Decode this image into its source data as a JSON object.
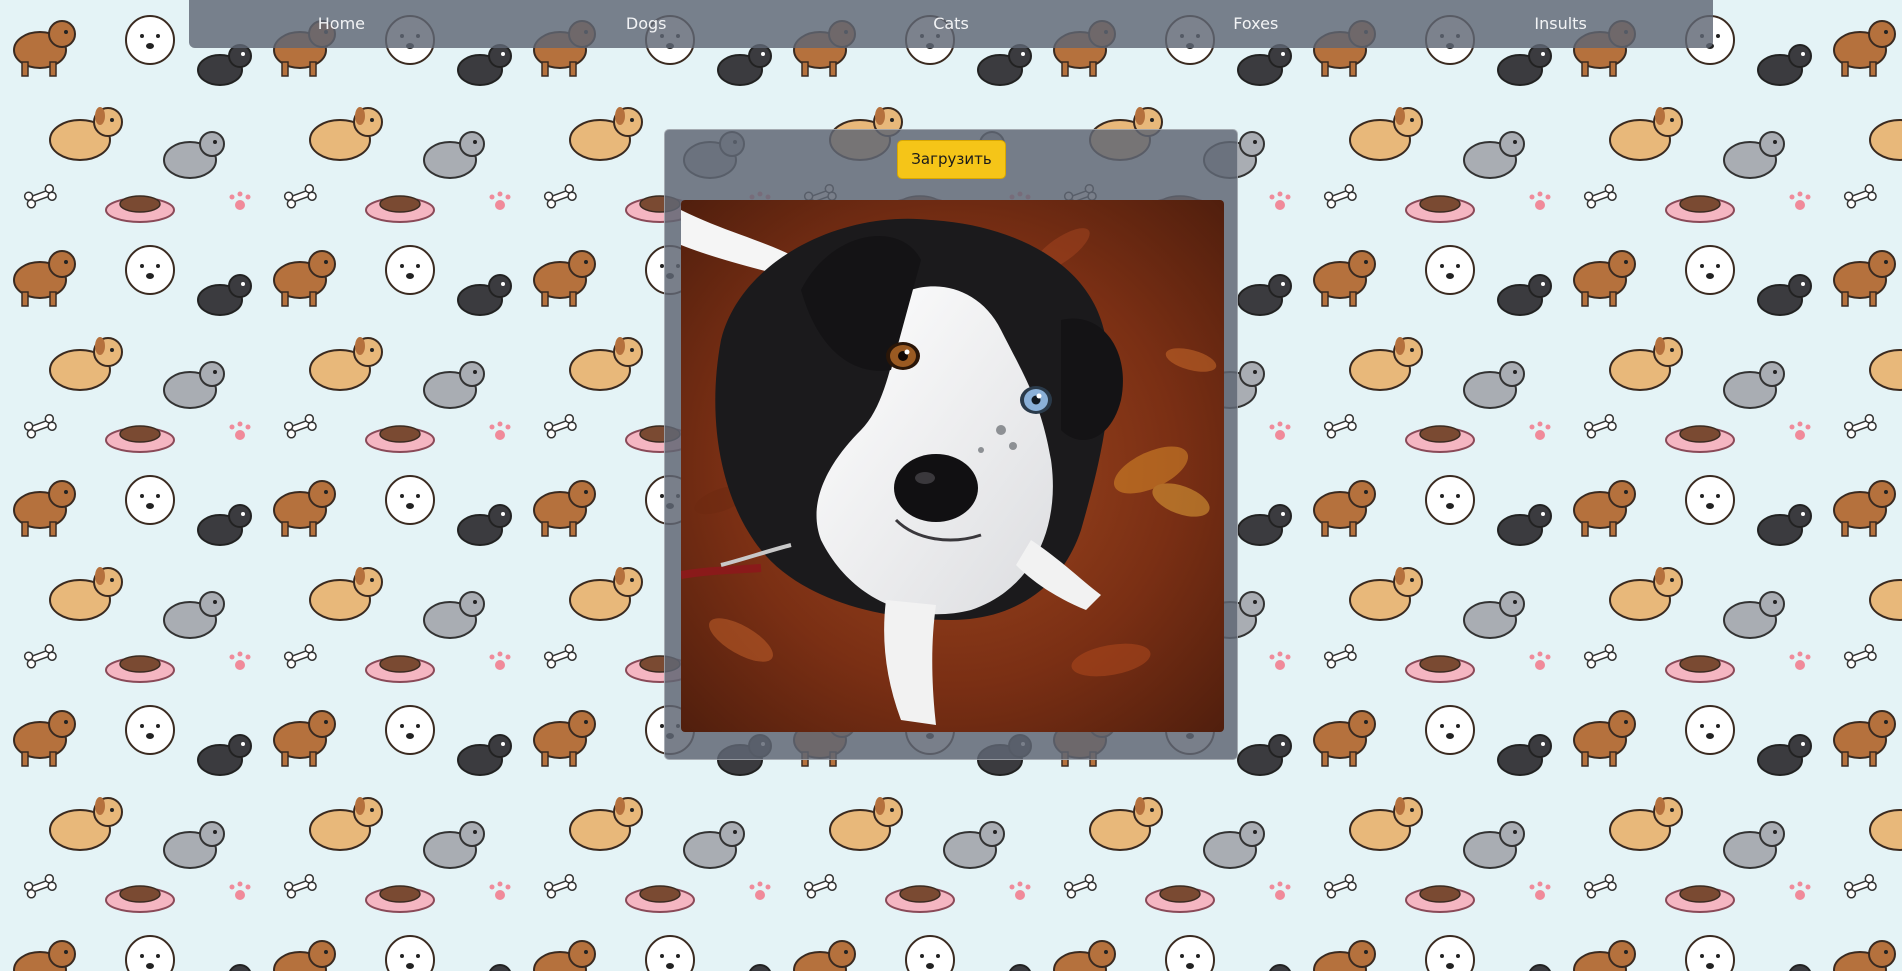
{
  "nav": {
    "items": [
      {
        "label": "Home"
      },
      {
        "label": "Dogs"
      },
      {
        "label": "Cats"
      },
      {
        "label": "Foxes"
      },
      {
        "label": "Insults"
      }
    ]
  },
  "panel": {
    "load_button_label": "Загрузить"
  },
  "photo": {
    "alt": "border collie with one brown and one blue eye sitting on autumn leaves"
  },
  "colors": {
    "navbar_bg": "#5f6674",
    "panel_bg": "#5f6674",
    "button_bg": "#f5c518",
    "wallpaper_bg": "#e4f3f6"
  },
  "icons": {
    "background": "cartoon-dogs-pattern"
  }
}
